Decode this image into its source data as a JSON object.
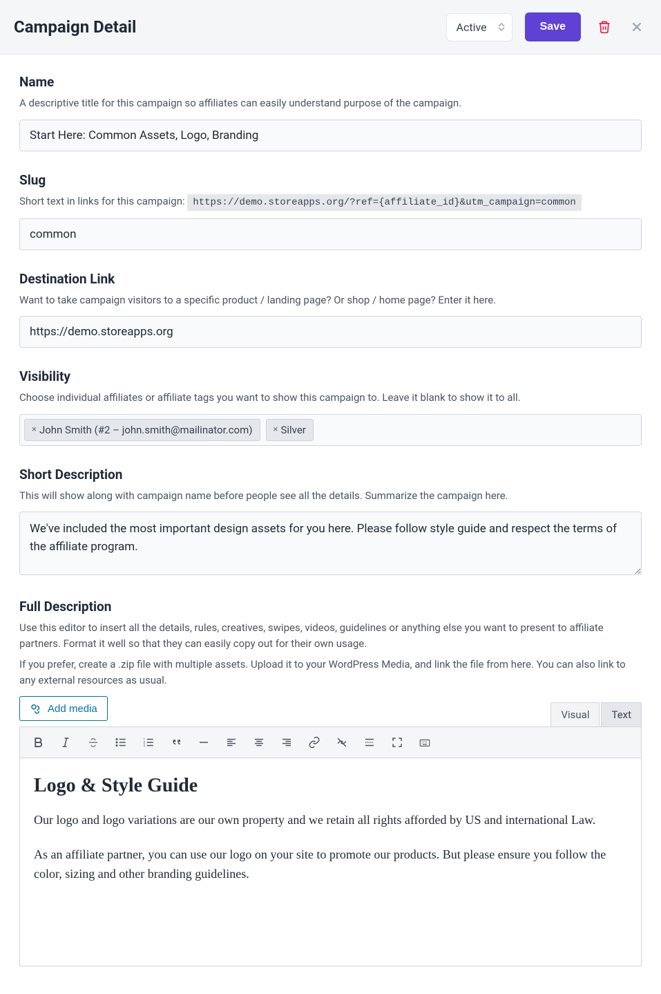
{
  "header": {
    "title": "Campaign Detail",
    "status_value": "Active",
    "save_label": "Save"
  },
  "name": {
    "label": "Name",
    "help": "A descriptive title for this campaign so affiliates can easily understand purpose of the campaign.",
    "value": "Start Here: Common Assets, Logo, Branding"
  },
  "slug": {
    "label": "Slug",
    "help_prefix": "Short text in links for this campaign: ",
    "help_code": "https://demo.storeapps.org/?ref={affiliate_id}&utm_campaign=common",
    "value": "common"
  },
  "destination": {
    "label": "Destination Link",
    "help": "Want to take campaign visitors to a specific product / landing page? Or shop / home page? Enter it here.",
    "value": "https://demo.storeapps.org"
  },
  "visibility": {
    "label": "Visibility",
    "help": "Choose individual affiliates or affiliate tags you want to show this campaign to. Leave it blank to show it to all.",
    "tags": [
      "John Smith (#2 – john.smith@mailinator.com)",
      "Silver"
    ]
  },
  "short_desc": {
    "label": "Short Description",
    "help": "This will show along with campaign name before people see all the details. Summarize the campaign here.",
    "value": "We've included the most important design assets for you here. Please follow style guide and respect the terms of the affiliate program."
  },
  "full_desc": {
    "label": "Full Description",
    "help1": "Use this editor to insert all the details, rules, creatives, swipes, videos, guidelines or anything else you want to present to affiliate partners. Format it well so that they can easily copy out for their own usage.",
    "help2": "If you prefer, create a .zip file with multiple assets. Upload it to your WordPress Media, and link the file from here. You can also link to any external resources as usual.",
    "add_media_label": "Add media",
    "tab_visual": "Visual",
    "tab_text": "Text",
    "content_heading": "Logo & Style Guide",
    "content_p1": "Our logo and logo variations are our own property and we retain all rights afforded by US and international Law.",
    "content_p2": "As an affiliate partner, you can use our logo on your site to promote our products. But please ensure you follow the color, sizing and other branding guidelines."
  }
}
